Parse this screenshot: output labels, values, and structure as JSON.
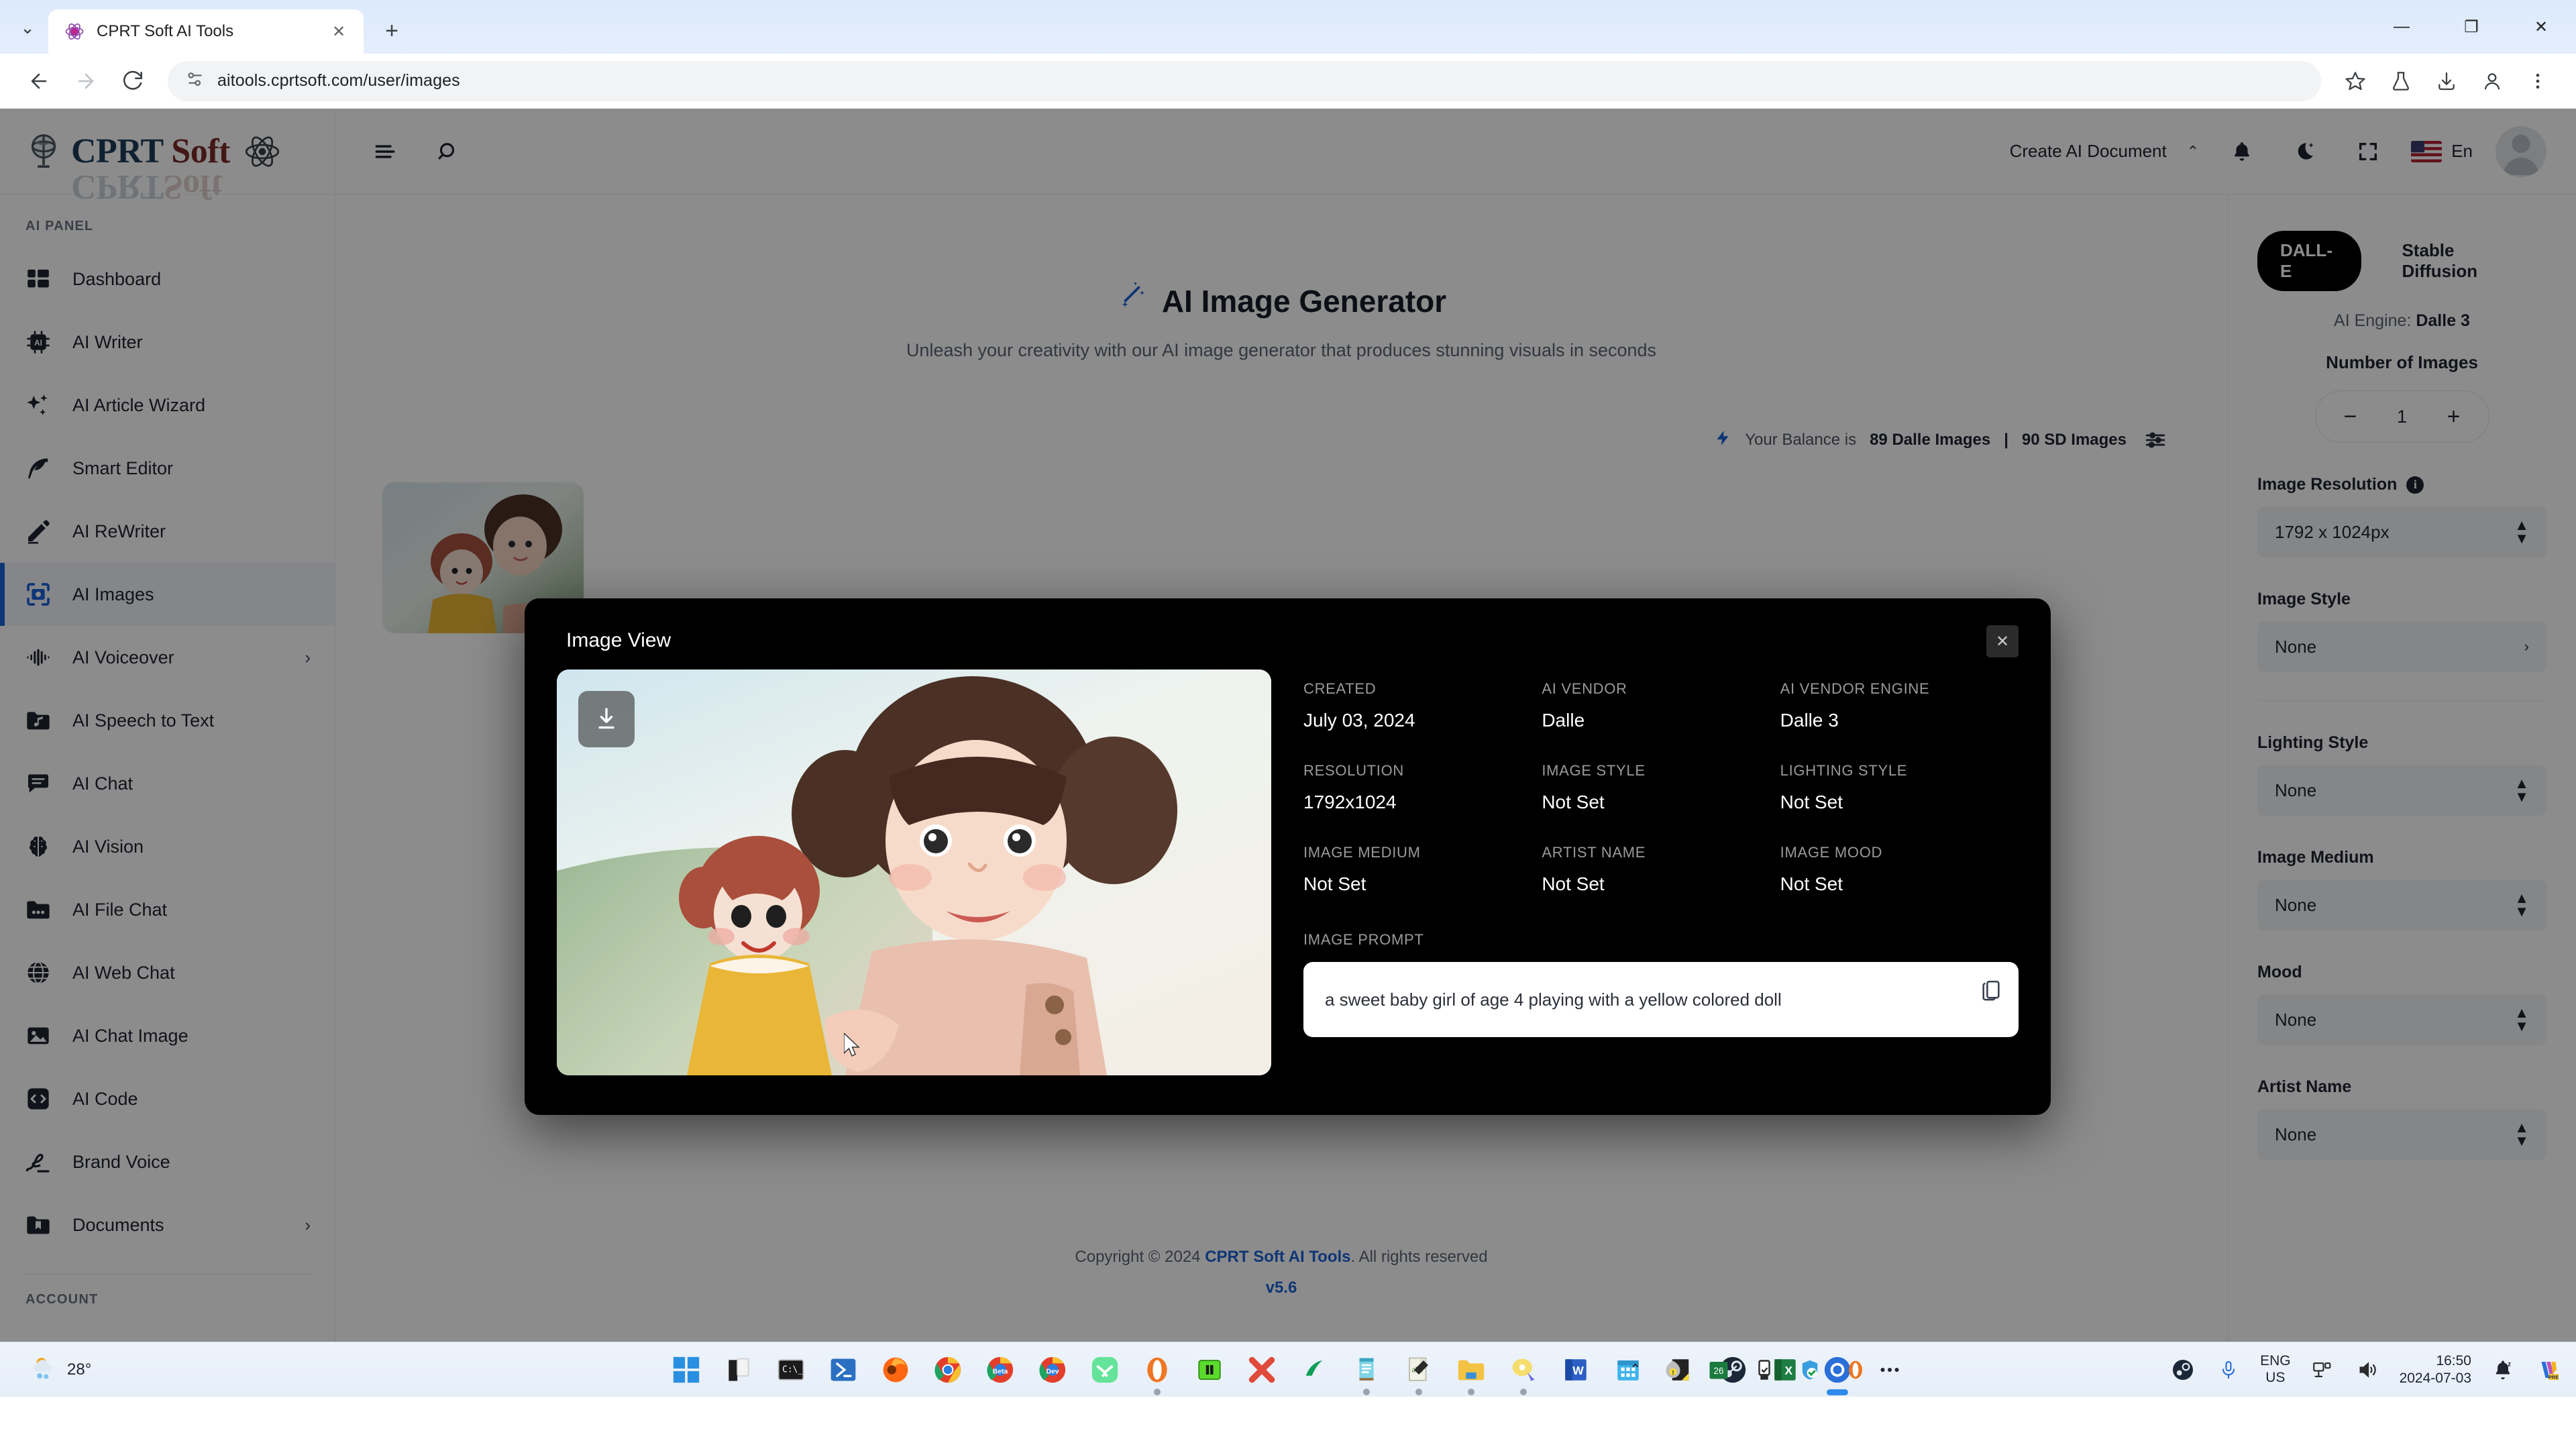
{
  "browser": {
    "tab": {
      "title": "CPRT Soft AI Tools",
      "close_label": "✕"
    },
    "new_tab_label": "+",
    "tabstrip_chevron": "⌄",
    "window_controls": {
      "minimize": "—",
      "maximize": "❐",
      "close": "✕"
    },
    "nav": {
      "back": "←",
      "forward": "→",
      "reload": "↻"
    },
    "url": "aitools.cprtsoft.com/user/images",
    "toolbar_icons": [
      "bookmark-star-icon",
      "labs-flask-icon",
      "downloads-icon",
      "profile-icon",
      "chrome-menu-icon"
    ]
  },
  "sidebar": {
    "brand": {
      "cprt": "CPRT",
      "soft": "Soft"
    },
    "section_title": "AI PANEL",
    "items": [
      {
        "label": "Dashboard",
        "icon": "dashboard-icon",
        "active": false,
        "chevron": ""
      },
      {
        "label": "AI Writer",
        "icon": "chip-ai-icon",
        "active": false,
        "chevron": ""
      },
      {
        "label": "AI Article Wizard",
        "icon": "sparkles-icon",
        "active": false,
        "chevron": ""
      },
      {
        "label": "Smart Editor",
        "icon": "feather-icon",
        "active": false,
        "chevron": ""
      },
      {
        "label": "AI ReWriter",
        "icon": "pencil-icon",
        "active": false,
        "chevron": ""
      },
      {
        "label": "AI Images",
        "icon": "image-scan-icon",
        "active": true,
        "chevron": ""
      },
      {
        "label": "AI Voiceover",
        "icon": "waveform-icon",
        "active": false,
        "chevron": "›"
      },
      {
        "label": "AI Speech to Text",
        "icon": "folder-music-icon",
        "active": false,
        "chevron": ""
      },
      {
        "label": "AI Chat",
        "icon": "chat-bubble-icon",
        "active": false,
        "chevron": ""
      },
      {
        "label": "AI Vision",
        "icon": "brain-icon",
        "active": false,
        "chevron": ""
      },
      {
        "label": "AI File Chat",
        "icon": "folder-dots-icon",
        "active": false,
        "chevron": ""
      },
      {
        "label": "AI Web Chat",
        "icon": "globe-icon",
        "active": false,
        "chevron": ""
      },
      {
        "label": "AI Chat Image",
        "icon": "picture-icon",
        "active": false,
        "chevron": ""
      },
      {
        "label": "AI Code",
        "icon": "code-brackets-icon",
        "active": false,
        "chevron": ""
      },
      {
        "label": "Brand Voice",
        "icon": "signature-icon",
        "active": false,
        "chevron": ""
      },
      {
        "label": "Documents",
        "icon": "folder-bookmark-icon",
        "active": false,
        "chevron": "›"
      }
    ],
    "account_section_title": "ACCOUNT"
  },
  "topbar": {
    "menu_icon": "hamburger-icon",
    "search_icon": "search-icon",
    "create_doc_label": "Create AI Document",
    "create_doc_caret": "⌃",
    "bell_icon": "bell-icon",
    "theme_icon": "moon-icon",
    "fullscreen_icon": "fullscreen-icon",
    "lang_label": "En",
    "avatar": "user-avatar"
  },
  "hero": {
    "title": "AI Image Generator",
    "subtitle": "Unleash your creativity with our AI image generator that produces stunning visuals in seconds"
  },
  "balance": {
    "prefix": "Your Balance is ",
    "dalle": "89 Dalle Images",
    "separator": " | ",
    "sd": "90 SD Images"
  },
  "footer": {
    "copyright_prefix": "Copyright © 2024 ",
    "brand": "CPRT Soft AI Tools",
    "copyright_suffix": ". All rights reserved",
    "version": "v5.6"
  },
  "settings": {
    "engines": [
      {
        "label": "DALL-E",
        "active": true
      },
      {
        "label": "Stable Diffusion",
        "active": false
      }
    ],
    "engine_line_prefix": "AI Engine: ",
    "engine_line_value": "Dalle 3",
    "number_of_images_label": "Number of Images",
    "number_of_images_value": "1",
    "minus": "−",
    "plus": "+",
    "fields": [
      {
        "label": "Image Resolution",
        "value": "1792 x 1024px",
        "info": true,
        "arrow": "updown"
      },
      {
        "label": "Image Style",
        "value": "None",
        "info": false,
        "arrow": "right"
      },
      {
        "label": "Lighting Style",
        "value": "None",
        "info": false,
        "arrow": "updown"
      },
      {
        "label": "Image Medium",
        "value": "None",
        "info": false,
        "arrow": "updown"
      },
      {
        "label": "Mood",
        "value": "None",
        "info": false,
        "arrow": "updown"
      },
      {
        "label": "Artist Name",
        "value": "None",
        "info": false,
        "arrow": "updown"
      }
    ],
    "info_glyph": "i"
  },
  "modal": {
    "title": "Image View",
    "close_label": "✕",
    "download_icon": "download-icon",
    "copy_icon": "copy-icon",
    "meta": [
      {
        "key": "CREATED",
        "value": "July 03, 2024"
      },
      {
        "key": "AI VENDOR",
        "value": "Dalle"
      },
      {
        "key": "AI VENDOR ENGINE",
        "value": "Dalle 3"
      },
      {
        "key": "RESOLUTION",
        "value": "1792x1024"
      },
      {
        "key": "IMAGE STYLE",
        "value": "Not Set"
      },
      {
        "key": "LIGHTING STYLE",
        "value": "Not Set"
      },
      {
        "key": "IMAGE MEDIUM",
        "value": "Not Set"
      },
      {
        "key": "ARTIST NAME",
        "value": "Not Set"
      },
      {
        "key": "IMAGE MOOD",
        "value": "Not Set"
      }
    ],
    "prompt_label": "IMAGE PROMPT",
    "prompt_value": "a sweet baby girl of age 4 playing with a yellow colored doll"
  },
  "taskbar": {
    "weather_temp": "28°",
    "apps": [
      "windows-start-icon",
      "file-explorer-icon",
      "terminal-icon",
      "powershell-icon",
      "firefox-icon",
      "chrome-icon",
      "chrome-beta-icon",
      "chrome-dev-icon",
      "messenger-icon",
      "opera-icon",
      "vm-icon",
      "xampp-icon",
      "anaconda-icon",
      "notepad-plus-icon",
      "sublime-icon",
      "folder-icon",
      "paint-icon",
      "word-icon",
      "calendar-icon",
      "keep-icon",
      "steam-icon",
      "excel-icon",
      "edge-icon",
      "overflow-icon"
    ],
    "tray_chevron": "⌃",
    "tray_icons": [
      "antivirus-icon",
      "calendar-26-icon",
      "usb-eject-icon",
      "defender-icon",
      "opera-tray-icon"
    ],
    "right_icons": [
      "steam-tray-icon",
      "mic-icon"
    ],
    "keyboard_lang_line1": "ENG",
    "keyboard_lang_line2": "US",
    "network_icon": "network-icon",
    "volume_icon": "volume-icon",
    "clock_time": "16:50",
    "clock_date": "2024-07-03",
    "notification_icon": "do-not-disturb-icon",
    "copilot_icon": "copilot-pre-icon"
  },
  "colors": {
    "accent_blue": "#1a63d8",
    "modal_bg": "#000000",
    "sidebar_active": "#f2f5fa"
  }
}
